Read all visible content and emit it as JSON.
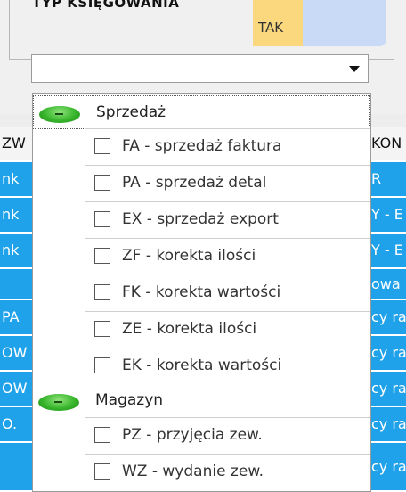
{
  "form": {
    "label": "TYP KSIĘGOWANIA",
    "tak_label": "TAK",
    "combo_value": ""
  },
  "grid_left": [
    {
      "text": "ZW",
      "header": true
    },
    {
      "text": "nk"
    },
    {
      "text": "nk"
    },
    {
      "text": "nk"
    },
    {
      "text": ""
    },
    {
      "text": "PA"
    },
    {
      "text": "OW"
    },
    {
      "text": "OW"
    },
    {
      "text": "O."
    },
    {
      "text": ""
    }
  ],
  "grid_right": [
    {
      "text": "KON",
      "header": true
    },
    {
      "text": "R"
    },
    {
      "text": "Y - E"
    },
    {
      "text": "Y - E"
    },
    {
      "text": "owa"
    },
    {
      "text": "cy ra"
    },
    {
      "text": "cy ra"
    },
    {
      "text": "cy ra"
    },
    {
      "text": "cy ra"
    },
    {
      "text": "cy ra"
    }
  ],
  "dropdown": {
    "groups": [
      {
        "label": "Sprzedaż",
        "selected": true,
        "items": [
          "FA - sprzedaż faktura",
          "PA - sprzedaż detal",
          "EX - sprzedaż export",
          "ZF - korekta ilości",
          "FK - korekta wartości",
          "ZE - korekta ilości",
          "EK - korekta wartości"
        ]
      },
      {
        "label": "Magazyn",
        "selected": false,
        "items": [
          "PZ - przyjęcia zew.",
          "WZ - wydanie zew."
        ]
      }
    ]
  },
  "colors": {
    "grid_highlight": "#1fa2ea",
    "tak_bg": "#fbd77e",
    "group_pill": "#37b52b"
  }
}
